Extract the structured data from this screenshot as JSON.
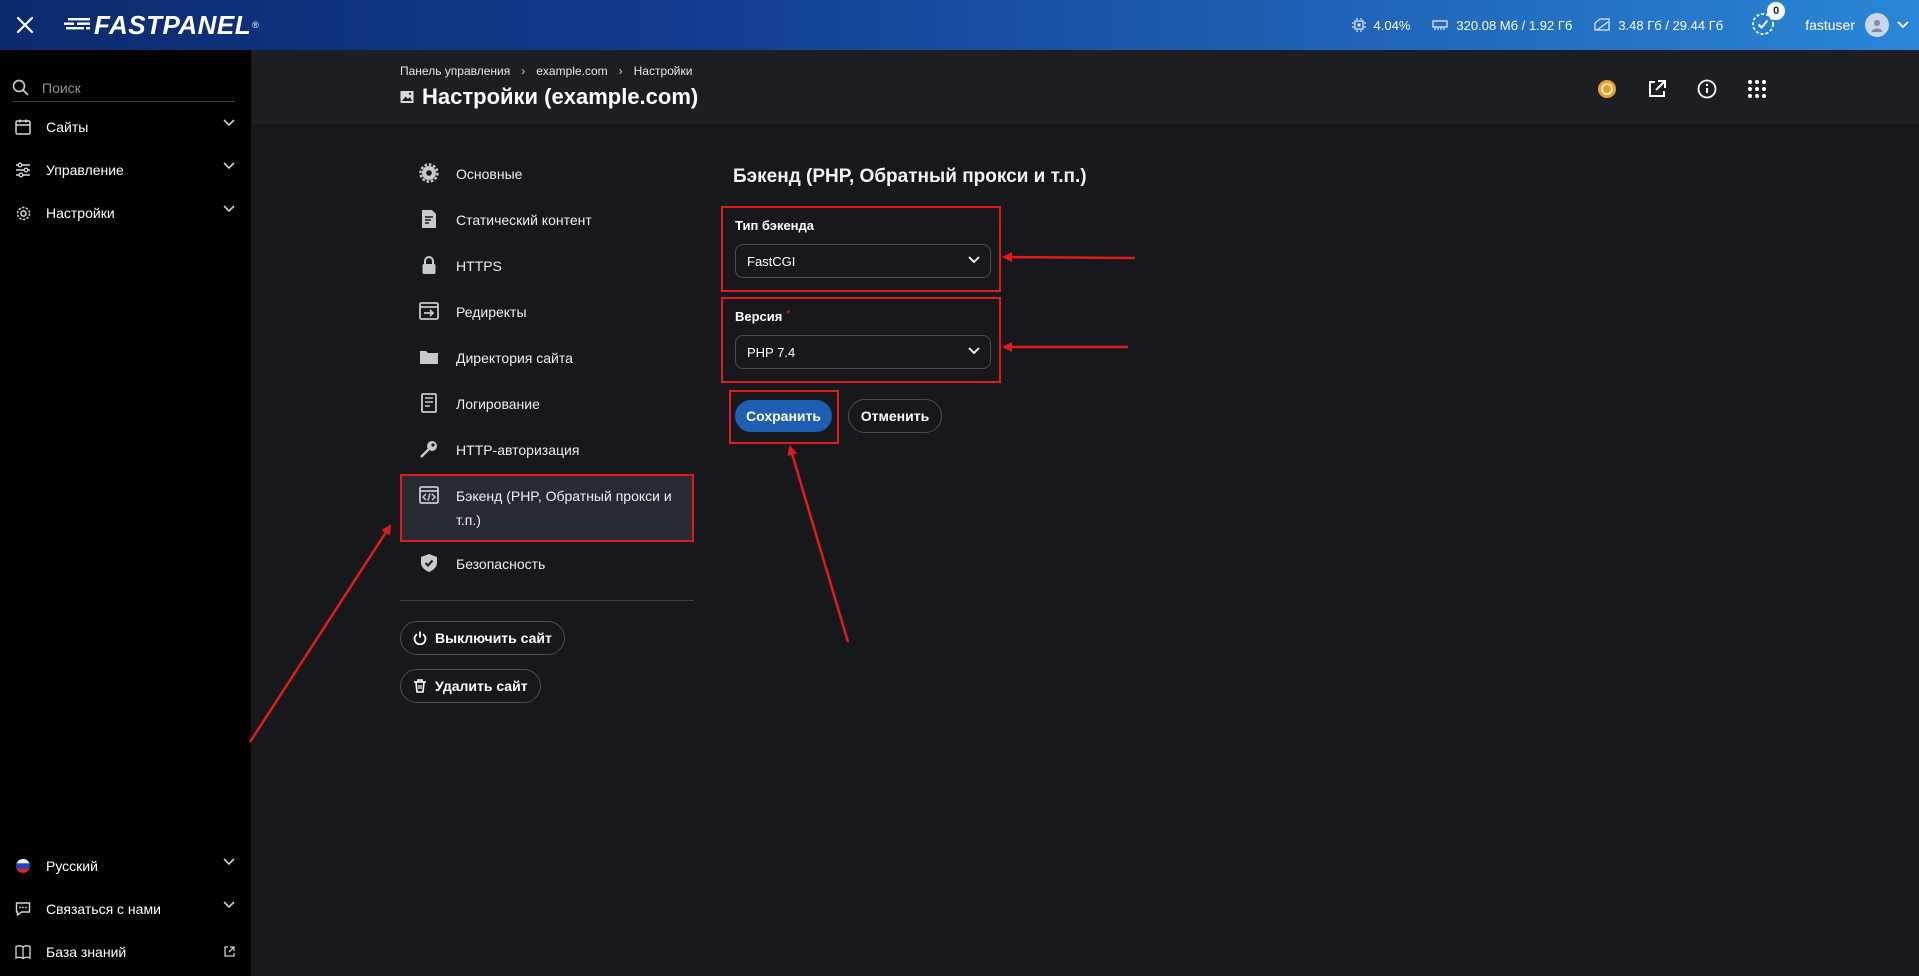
{
  "topbar": {
    "brand": "FASTPANEL",
    "brand_mark": "®",
    "cpu": "4.04%",
    "memory": "320.08 Мб / 1.92 Гб",
    "disk": "3.48 Гб / 29.44 Гб",
    "notifications_count": "0",
    "username": "fastuser"
  },
  "sidebar": {
    "search_placeholder": "Поиск",
    "items": [
      {
        "label": "Сайты",
        "icon": "calendar-icon"
      },
      {
        "label": "Управление",
        "icon": "sliders-icon"
      },
      {
        "label": "Настройки",
        "icon": "gear-icon"
      }
    ],
    "bottom": [
      {
        "label": "Русский",
        "icon": "russia-flag-icon"
      },
      {
        "label": "Связаться с нами",
        "icon": "chat-icon"
      },
      {
        "label": "База знаний",
        "icon": "book-icon"
      }
    ]
  },
  "breadcrumb": [
    "Панель управления",
    "example.com",
    "Настройки"
  ],
  "page": {
    "title": "Настройки (example.com)"
  },
  "settings_menu": [
    {
      "label": "Основные",
      "icon": "gear-icon"
    },
    {
      "label": "Статический контент",
      "icon": "document-icon"
    },
    {
      "label": "HTTPS",
      "icon": "lock-icon"
    },
    {
      "label": "Редиректы",
      "icon": "redirect-icon"
    },
    {
      "label": "Директория сайта",
      "icon": "folder-icon"
    },
    {
      "label": "Логирование",
      "icon": "log-icon"
    },
    {
      "label": "HTTP-авторизация",
      "icon": "key-icon"
    },
    {
      "label": "Бэкенд (PHP, Обратный прокси и т.п.)",
      "icon": "code-icon",
      "active": true
    },
    {
      "label": "Безопасность",
      "icon": "shield-icon"
    }
  ],
  "site_actions": {
    "disable": "Выключить сайт",
    "delete": "Удалить сайт"
  },
  "form": {
    "title": "Бэкенд (PHP, Обратный прокси и т.п.)",
    "backend_type_label": "Тип бэкенда",
    "backend_type_value": "FastCGI",
    "version_label": "Версия",
    "version_required_mark": "*",
    "version_value": "PHP 7.4",
    "save": "Сохранить",
    "cancel": "Отменить"
  },
  "colors": {
    "accent": "#1f5fb3",
    "highlight": "#e01b1b",
    "topbar_start": "#0b2a6e",
    "topbar_end": "#2a86d6"
  }
}
